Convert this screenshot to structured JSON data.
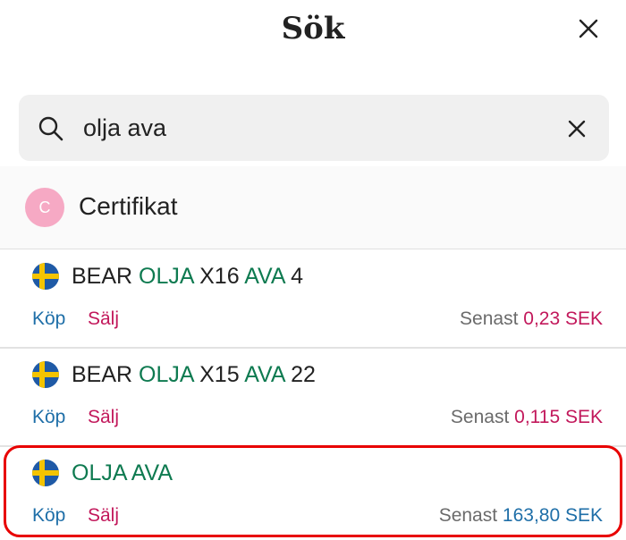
{
  "header": {
    "title": "Sök",
    "close_icon": "close-icon"
  },
  "search": {
    "value": "olja ava",
    "search_icon": "search-icon",
    "clear_icon": "clear-icon"
  },
  "section": {
    "avatar_letter": "C",
    "avatar_color": "#f6a9c4",
    "label": "Certifikat"
  },
  "results": [
    {
      "flag": "sweden-flag-icon",
      "parts": [
        "BEAR ",
        "OLJA",
        " X16 ",
        "AVA",
        " 4"
      ],
      "buy_label": "Köp",
      "sell_label": "Sälj",
      "latest_label": "Senast ",
      "price": "0,23 SEK"
    },
    {
      "flag": "sweden-flag-icon",
      "parts": [
        "BEAR ",
        "OLJA",
        " X15 ",
        "AVA",
        " 22"
      ],
      "buy_label": "Köp",
      "sell_label": "Sälj",
      "latest_label": "Senast ",
      "price": "0,115 SEK"
    },
    {
      "flag": "sweden-flag-icon",
      "parts": [
        "OLJA AVA"
      ],
      "buy_label": "Köp",
      "sell_label": "Sälj",
      "latest_label": "Senast ",
      "price": "163,80 SEK"
    }
  ],
  "colors": {
    "highlight": "#0e7a50",
    "buy": "#1f6fa8",
    "sell": "#c2185b",
    "selection_border": "#e80000"
  }
}
